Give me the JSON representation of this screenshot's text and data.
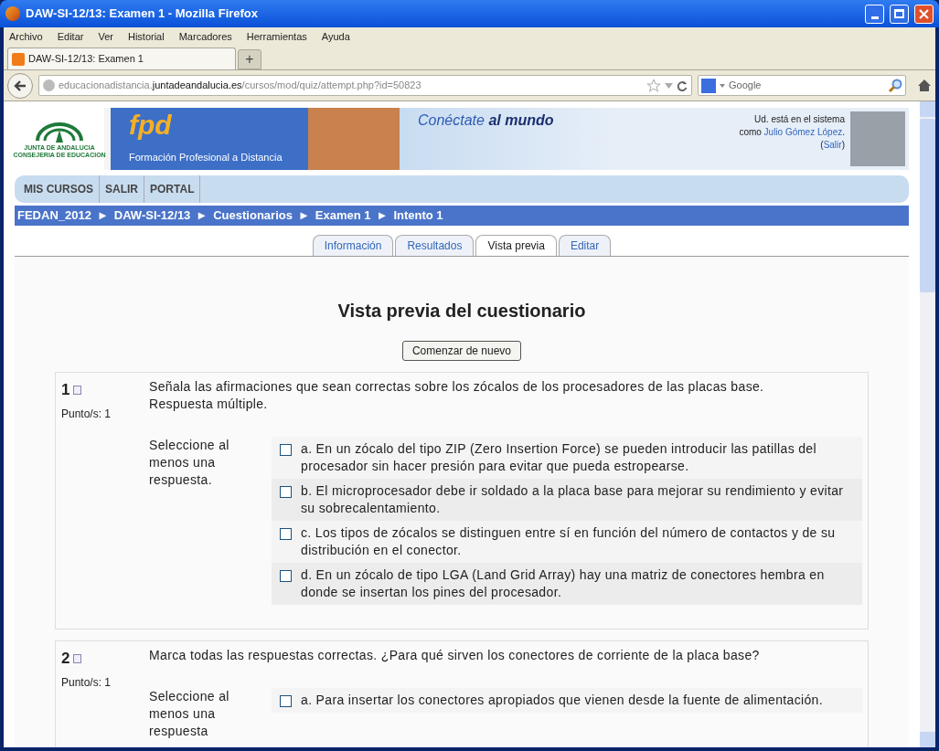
{
  "window": {
    "title": "DAW-SI-12/13: Examen 1 - Mozilla Firefox"
  },
  "menu": [
    "Archivo",
    "Editar",
    "Ver",
    "Historial",
    "Marcadores",
    "Herramientas",
    "Ayuda"
  ],
  "browser_tabs": [
    {
      "label": "DAW-SI-12/13: Examen 1",
      "selected": true
    }
  ],
  "new_tab": "+",
  "address": {
    "prefix": "educacionadistancia.",
    "domain": "juntadeandalucia.es",
    "path": "/cursos/mod/quiz/attempt.php?id=50823"
  },
  "search": {
    "placeholder": "Google"
  },
  "banner": {
    "junta_line1": "JUNTA DE ANDALUCIA",
    "junta_line2": "CONSEJERIA DE EDUCACION",
    "fpd": "fpd",
    "fpd_sub": "Formación Profesional a Distancia",
    "slogan_1": "Conéctate",
    "slogan_2": "al mundo",
    "user_prefix": "Ud. está en el sistema como",
    "user_name": "Julio Gómez López",
    "user_sep": ". (",
    "logout": "Salir",
    "user_end": ")"
  },
  "nav": [
    "MIS CURSOS",
    "SALIR",
    "PORTAL"
  ],
  "breadcrumb": [
    "FEDAN_2012",
    "DAW-SI-12/13",
    "Cuestionarios",
    "Examen 1",
    "Intento 1"
  ],
  "breadcrumb_separator": "►",
  "page_tabs": [
    {
      "label": "Información",
      "selected": false
    },
    {
      "label": "Resultados",
      "selected": false
    },
    {
      "label": "Vista previa",
      "selected": true
    },
    {
      "label": "Editar",
      "selected": false
    }
  ],
  "heading": "Vista previa del cuestionario",
  "restart_button": "Comenzar de nuevo",
  "questions": [
    {
      "number": "1",
      "points": "Punto/s: 1",
      "text": "Señala las afirmaciones que sean correctas sobre los zócalos de los procesadores de las placas base. Respuesta múltiple.",
      "instruction": "Seleccione al menos una respuesta.",
      "options": [
        {
          "text": "a. En un zócalo del tipo ZIP (Zero Insertion Force) se pueden introducir las patillas del procesador sin hacer presión para evitar que pueda estropearse.",
          "checked": false
        },
        {
          "text": "b. El microprocesador debe ir soldado a la placa base para mejorar su rendimiento y evitar su sobrecalentamiento.",
          "checked": false
        },
        {
          "text": "c. Los tipos de zócalos se distinguen entre sí en función del número de contactos y de su distribución en el conector.",
          "checked": false
        },
        {
          "text": "d. En un zócalo de tipo LGA (Land Grid Array) hay una matriz de conectores hembra en donde se insertan los pines del procesador.",
          "checked": false
        }
      ]
    },
    {
      "number": "2",
      "points": "Punto/s: 1",
      "text": "Marca todas las respuestas correctas. ¿Para qué sirven los conectores de corriente de la placa base?",
      "instruction": "Seleccione al menos una respuesta",
      "options": [
        {
          "text": "a. Para insertar los conectores apropiados que vienen desde la fuente de alimentación.",
          "checked": false
        }
      ]
    }
  ]
}
